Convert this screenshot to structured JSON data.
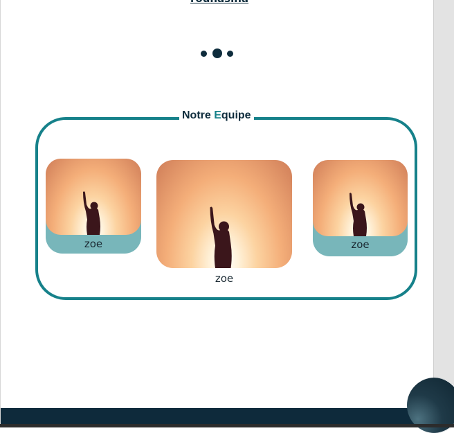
{
  "top_link": "rounasina",
  "carousel": {
    "dot_count": 3,
    "active_index": 1
  },
  "team": {
    "title_part1": "Notre ",
    "title_accent": "E",
    "title_part2": "quipe",
    "members": [
      {
        "name": "zoe"
      },
      {
        "name": "zoe"
      },
      {
        "name": "zoe"
      }
    ]
  },
  "colors": {
    "accent": "#16818a",
    "navy": "#0e2c3c",
    "card_bg": "#78b6ba"
  }
}
